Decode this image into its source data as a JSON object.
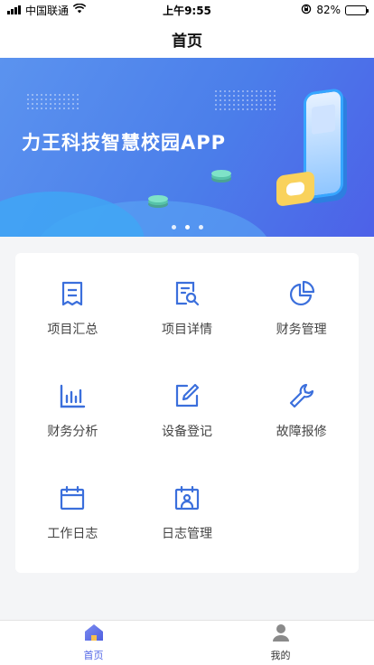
{
  "status_bar": {
    "carrier": "中国联通",
    "time": "上午9:55",
    "battery_percent": "82%",
    "battery_level": 0.82
  },
  "nav": {
    "title": "首页"
  },
  "banner": {
    "title": "力王科技智慧校园APP",
    "active_slide": 1,
    "slide_count": 3
  },
  "menu": {
    "items": [
      {
        "label": "项目汇总",
        "icon": "document-list-icon"
      },
      {
        "label": "项目详情",
        "icon": "document-search-icon"
      },
      {
        "label": "财务管理",
        "icon": "pie-chart-icon"
      },
      {
        "label": "财务分析",
        "icon": "bar-chart-icon"
      },
      {
        "label": "设备登记",
        "icon": "edit-icon"
      },
      {
        "label": "故障报修",
        "icon": "wrench-icon"
      },
      {
        "label": "工作日志",
        "icon": "calendar-icon"
      },
      {
        "label": "日志管理",
        "icon": "calendar-user-icon"
      }
    ]
  },
  "tab_bar": {
    "items": [
      {
        "label": "首页",
        "icon": "home-icon",
        "active": true
      },
      {
        "label": "我的",
        "icon": "user-icon",
        "active": false
      }
    ]
  },
  "colors": {
    "accent": "#4f64e6",
    "icon_blue": "#3b6fdc",
    "banner_start": "#5b93ef",
    "banner_end": "#4d61e8"
  }
}
